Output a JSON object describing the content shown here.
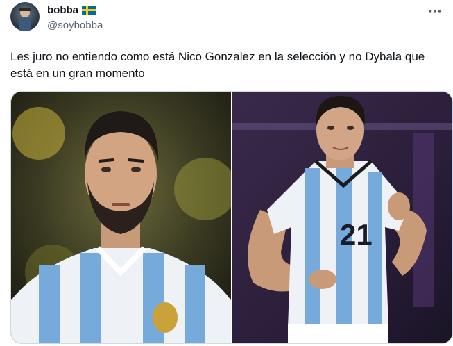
{
  "author": {
    "display_name": "bobba",
    "handle": "@soybobba",
    "flag_icon": "sweden-flag-icon"
  },
  "tweet": {
    "text": "Les juro no entiendo como está Nico Gonzalez en la selección y no Dybala que está en un gran momento"
  },
  "media": {
    "images": [
      {
        "subject": "player-photo-left"
      },
      {
        "subject": "player-photo-right"
      }
    ],
    "jersey_number": "21"
  },
  "colors": {
    "text": "#0f1419",
    "secondary": "#536471",
    "border": "#cfd9de",
    "albiceleste": "#75aadb"
  }
}
